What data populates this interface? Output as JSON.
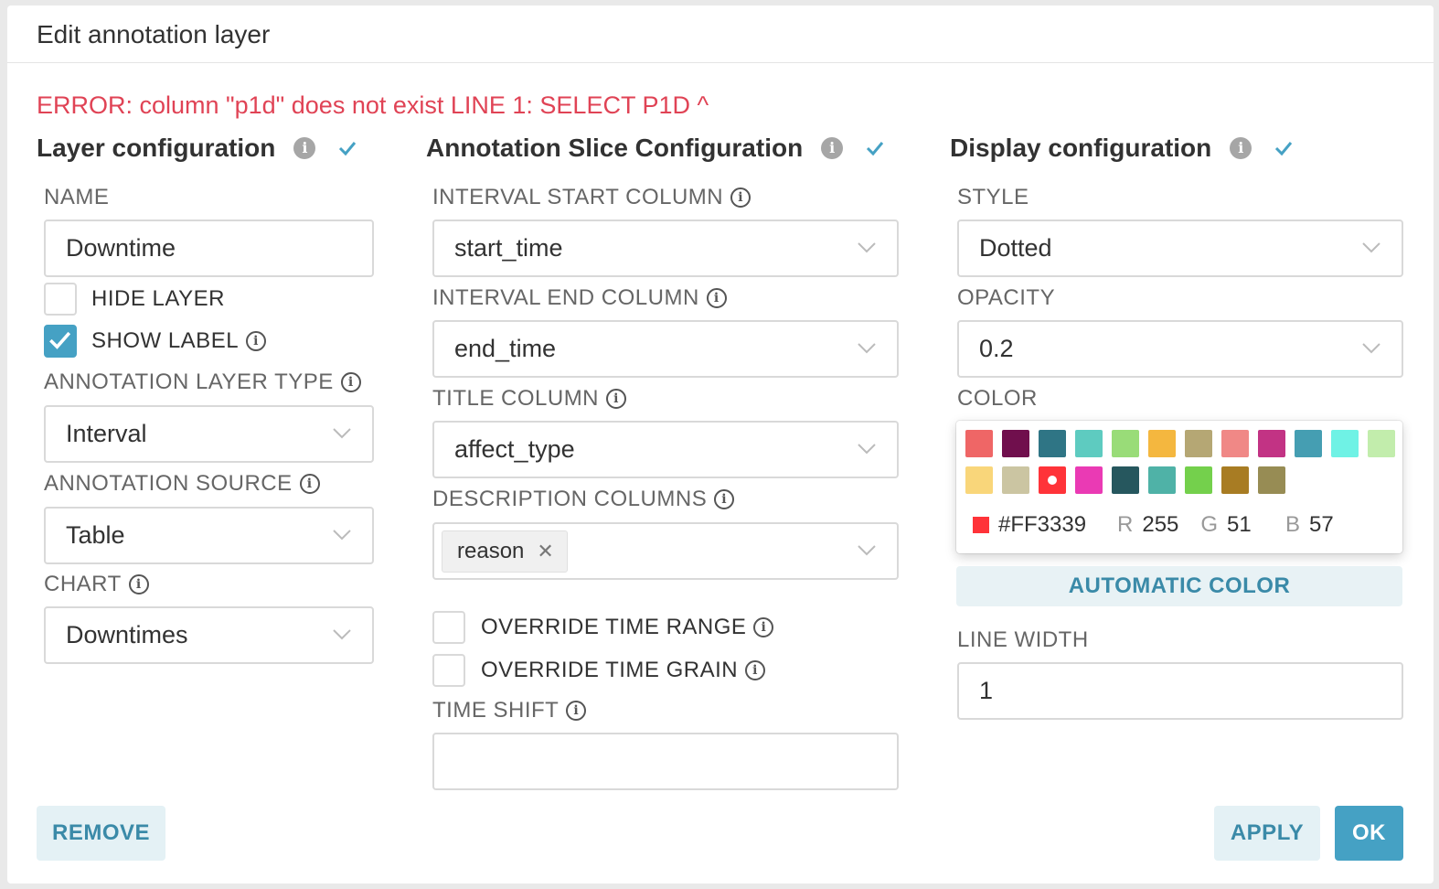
{
  "modal": {
    "title": "Edit annotation layer"
  },
  "error": "ERROR: column \"p1d\" does not exist LINE 1: SELECT P1D ^",
  "layer": {
    "title": "Layer configuration",
    "name_label": "NAME",
    "name_value": "Downtime",
    "hide_layer_label": "HIDE LAYER",
    "hide_layer_checked": false,
    "show_label_label": "SHOW LABEL",
    "show_label_checked": true,
    "type_label": "ANNOTATION LAYER TYPE",
    "type_value": "Interval",
    "source_label": "ANNOTATION SOURCE",
    "source_value": "Table",
    "chart_label": "CHART",
    "chart_value": "Downtimes"
  },
  "slice": {
    "title": "Annotation Slice Configuration",
    "start_label": "INTERVAL START COLUMN",
    "start_value": "start_time",
    "end_label": "INTERVAL END COLUMN",
    "end_value": "end_time",
    "title_col_label": "TITLE COLUMN",
    "title_col_value": "affect_type",
    "desc_label": "DESCRIPTION COLUMNS",
    "desc_tag": "reason",
    "override_range_label": "OVERRIDE TIME RANGE",
    "override_grain_label": "OVERRIDE TIME GRAIN",
    "time_shift_label": "TIME SHIFT",
    "time_shift_value": ""
  },
  "display": {
    "title": "Display configuration",
    "style_label": "STYLE",
    "style_value": "Dotted",
    "opacity_label": "OPACITY",
    "opacity_value": "0.2",
    "color_label": "COLOR",
    "swatches": [
      "#ef6666",
      "#700f4d",
      "#2f7585",
      "#5ecbc0",
      "#99dc78",
      "#f4b73f",
      "#b5a774",
      "#f08886",
      "#c23384",
      "#459eb2",
      "#6ff2e5",
      "#c2edac",
      "#f9d67a",
      "#cbc5a2",
      "#ff3339",
      "#ea3ab4",
      "#26575e",
      "#4fb2a7",
      "#74d04c",
      "#a87c23",
      "#978c54"
    ],
    "selected_hex": "#FF3339",
    "r_label": "R",
    "r_value": "255",
    "g_label": "G",
    "g_value": "51",
    "b_label": "B",
    "b_value": "57",
    "auto_color_label": "AUTOMATIC COLOR",
    "line_width_label": "LINE WIDTH",
    "line_width_value": "1"
  },
  "footer": {
    "remove_label": "REMOVE",
    "apply_label": "APPLY",
    "ok_label": "OK"
  },
  "colors": {
    "accent": "#45a1c4",
    "error": "#e04355"
  }
}
